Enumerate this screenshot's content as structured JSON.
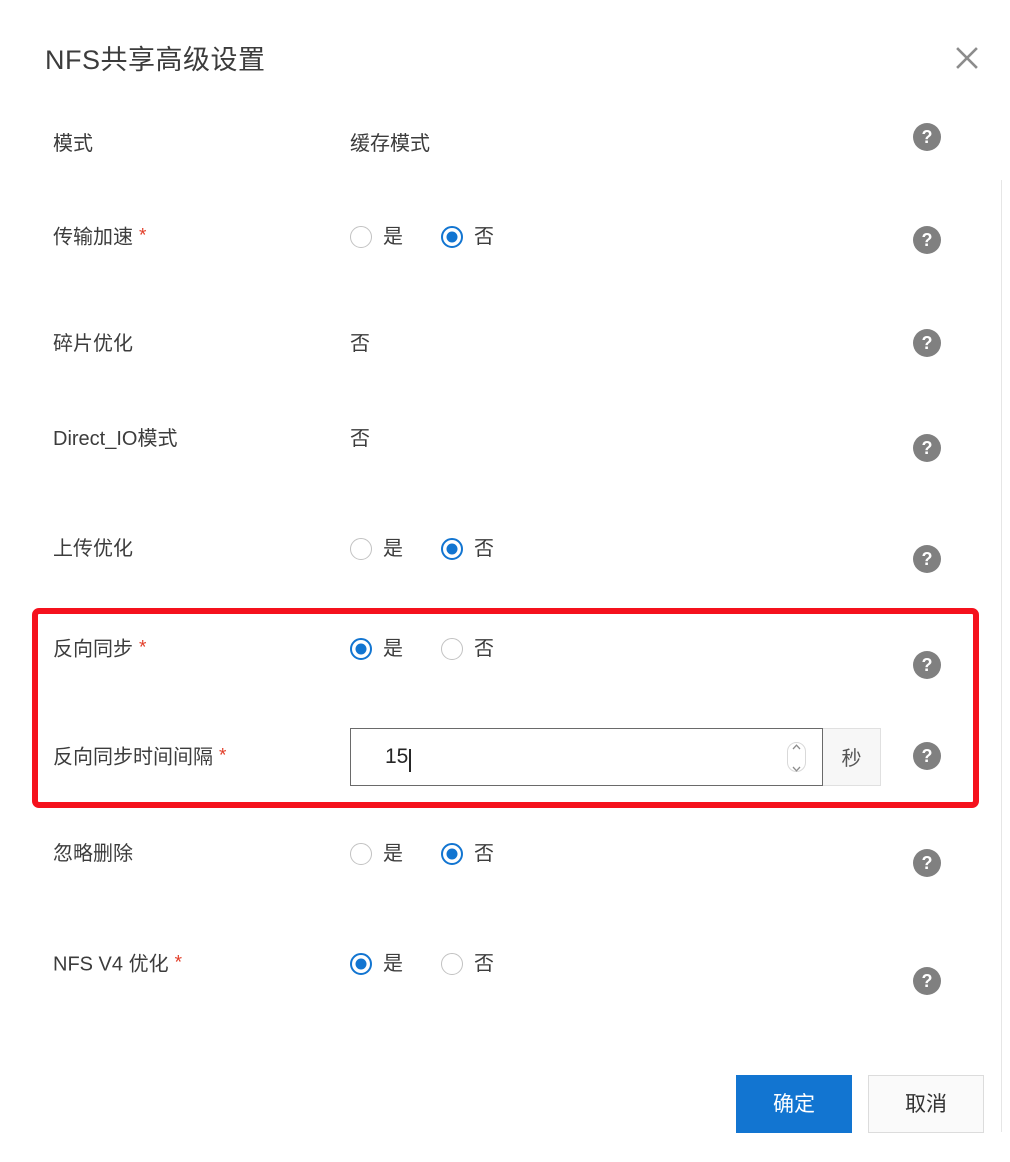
{
  "dialog": {
    "title": "NFS共享高级设置",
    "close_icon": "close-icon"
  },
  "rows": [
    {
      "label": "模式",
      "required": false,
      "control": "text",
      "value": "缓存模式",
      "help": "?"
    },
    {
      "label": "传输加速",
      "required": true,
      "control": "radio",
      "options": [
        "是",
        "否"
      ],
      "selected": "否",
      "help": "?"
    },
    {
      "label": "碎片优化",
      "required": false,
      "control": "text",
      "value": "否",
      "help": "?"
    },
    {
      "label": "Direct_IO模式",
      "required": false,
      "control": "text",
      "value": "否",
      "help": "?"
    },
    {
      "label": "上传优化",
      "required": false,
      "control": "radio",
      "options": [
        "是",
        "否"
      ],
      "selected": "否",
      "help": "?"
    },
    {
      "label": "反向同步",
      "required": true,
      "control": "radio",
      "options": [
        "是",
        "否"
      ],
      "selected": "是",
      "help": "?"
    },
    {
      "label": "反向同步时间间隔",
      "required": true,
      "control": "number",
      "value": "15",
      "unit": "秒",
      "help": "?"
    },
    {
      "label": "忽略删除",
      "required": false,
      "control": "radio",
      "options": [
        "是",
        "否"
      ],
      "selected": "否",
      "help": "?"
    },
    {
      "label": "NFS V4 优化",
      "required": true,
      "control": "radio",
      "options": [
        "是",
        "否"
      ],
      "selected": "是",
      "help": "?"
    }
  ],
  "required_marker": "*",
  "footer": {
    "confirm_label": "确定",
    "cancel_label": "取消"
  },
  "colors": {
    "accent": "#1275d1",
    "required_star": "#e23d28",
    "highlight_border": "#f5111d",
    "help_icon_bg": "#808080",
    "text": "#3c3c3c"
  }
}
